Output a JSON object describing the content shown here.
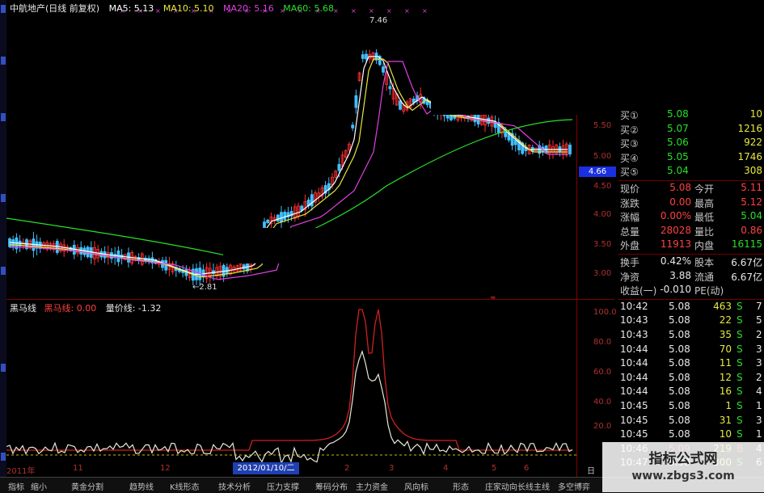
{
  "header": {
    "stock_name": "中航地产(日线 前复权)",
    "ma5": "MA5: 5.13",
    "ma10": "MA10: 5.10",
    "ma20": "MA20: 5.16",
    "ma60": "MA60: 5.68",
    "colors": {
      "ma5": "#ffffff",
      "ma10": "#e8e840",
      "ma20": "#e040e0",
      "ma60": "#28e028"
    }
  },
  "annotations": {
    "high": "7.46",
    "low": "2.81"
  },
  "price_axis": [
    "5.50",
    "5.00",
    "4.66",
    "4.50",
    "4.00",
    "3.50",
    "3.00"
  ],
  "current_marker": "4.66",
  "indicator": {
    "name": "黑马线",
    "black_horse_label": "黑马线: 0.00",
    "volume_price_label": "量价线: -1.32",
    "axis": [
      "100.0",
      "80.0",
      "60.0",
      "40.0",
      "20.0"
    ]
  },
  "dates": {
    "labels": [
      "2011年",
      "11",
      "12",
      "2",
      "3",
      "4",
      "5",
      "6",
      "日线"
    ],
    "selected": "2012/01/10/二"
  },
  "quote": {
    "bids": [
      {
        "label": "买①",
        "price": "5.08",
        "vol": "10"
      },
      {
        "label": "买②",
        "price": "5.07",
        "vol": "1216"
      },
      {
        "label": "买③",
        "price": "5.06",
        "vol": "922"
      },
      {
        "label": "买④",
        "price": "5.05",
        "vol": "1746"
      },
      {
        "label": "买⑤",
        "price": "5.04",
        "vol": "308"
      }
    ],
    "stats": [
      {
        "l1": "现价",
        "v1": "5.08",
        "l2": "今开",
        "v2": "5.11"
      },
      {
        "l1": "涨跌",
        "v1": "0.00",
        "l2": "最高",
        "v2": "5.12"
      },
      {
        "l1": "涨幅",
        "v1": "0.00%",
        "l2": "最低",
        "v2": "5.04"
      },
      {
        "l1": "总量",
        "v1": "28028",
        "l2": "量比",
        "v2": "0.86"
      },
      {
        "l1": "外盘",
        "v1": "11913",
        "l2": "内盘",
        "v2": "16115"
      }
    ],
    "stats2": [
      {
        "l1": "换手",
        "v1": "0.42%",
        "l2": "股本",
        "v2": "6.67亿"
      },
      {
        "l1": "净资",
        "v1": "3.88",
        "l2": "流通",
        "v2": "6.67亿"
      },
      {
        "l1": "收益(一)",
        "v1": "-0.010",
        "l2": "PE(动)",
        "v2": ""
      }
    ],
    "ticks": [
      {
        "t": "10:42",
        "p": "5.08",
        "v": "463",
        "s": "S",
        "n": "7"
      },
      {
        "t": "10:43",
        "p": "5.08",
        "v": "22",
        "s": "S",
        "n": "5"
      },
      {
        "t": "10:43",
        "p": "5.08",
        "v": "35",
        "s": "S",
        "n": "2"
      },
      {
        "t": "10:44",
        "p": "5.08",
        "v": "70",
        "s": "S",
        "n": "3"
      },
      {
        "t": "10:44",
        "p": "5.08",
        "v": "11",
        "s": "S",
        "n": "3"
      },
      {
        "t": "10:44",
        "p": "5.08",
        "v": "12",
        "s": "S",
        "n": "2"
      },
      {
        "t": "10:44",
        "p": "5.08",
        "v": "16",
        "s": "S",
        "n": "4"
      },
      {
        "t": "10:45",
        "p": "5.08",
        "v": "1",
        "s": "S",
        "n": "1"
      },
      {
        "t": "10:45",
        "p": "5.08",
        "v": "31",
        "s": "S",
        "n": "3"
      },
      {
        "t": "10:45",
        "p": "5.08",
        "v": "10",
        "s": "S",
        "n": "1"
      },
      {
        "t": "10:46",
        "p": "5.09",
        "v": "219",
        "s": "B",
        "n": "4"
      },
      {
        "t": "10:47",
        "p": "5.08",
        "v": "300",
        "s": "S",
        "n": "6"
      }
    ]
  },
  "bottom_tabs": [
    "指标",
    "缩小",
    "黄金分割",
    "趋势线",
    "K线形态",
    "技术分析",
    "压力支撑",
    "筹码分布",
    "主力资金",
    "风向标",
    "形态",
    "庄家动向",
    "长线主线",
    "多空博弈"
  ],
  "watermark": {
    "line1": "指标公式网",
    "line2": "www.zbgs3.com"
  }
}
